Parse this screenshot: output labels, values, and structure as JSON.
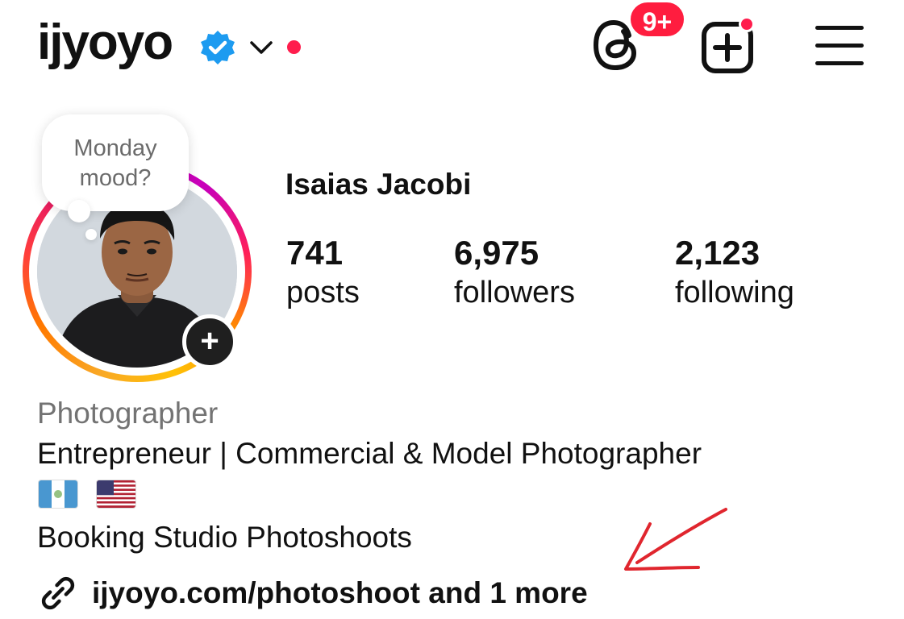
{
  "header": {
    "username": "ijyoyo",
    "threads_badge": "9+",
    "icons": [
      "verified-badge-icon",
      "chevron-down-icon",
      "threads-icon",
      "create-post-icon",
      "menu-icon"
    ]
  },
  "profile": {
    "note": "Monday mood?",
    "full_name": "Isaias Jacobi",
    "stats": [
      {
        "value": "741",
        "label": "posts"
      },
      {
        "value": "6,975",
        "label": "followers"
      },
      {
        "value": "2,123",
        "label": "following"
      }
    ],
    "category": "Photographer",
    "bio_line1": "Entrepreneur | Commercial & Model Photographer",
    "flags": [
      "guatemala-flag-icon",
      "usa-flag-icon"
    ],
    "bio_line3": "Booking Studio Photoshoots",
    "link": "ijyoyo.com/photoshoot and 1 more"
  },
  "colors": {
    "accent_blue": "#1d9bf0",
    "notification_red": "#ff1d4d",
    "annotation_red": "#e0262e",
    "text_primary": "#111111",
    "text_secondary": "#737373"
  }
}
